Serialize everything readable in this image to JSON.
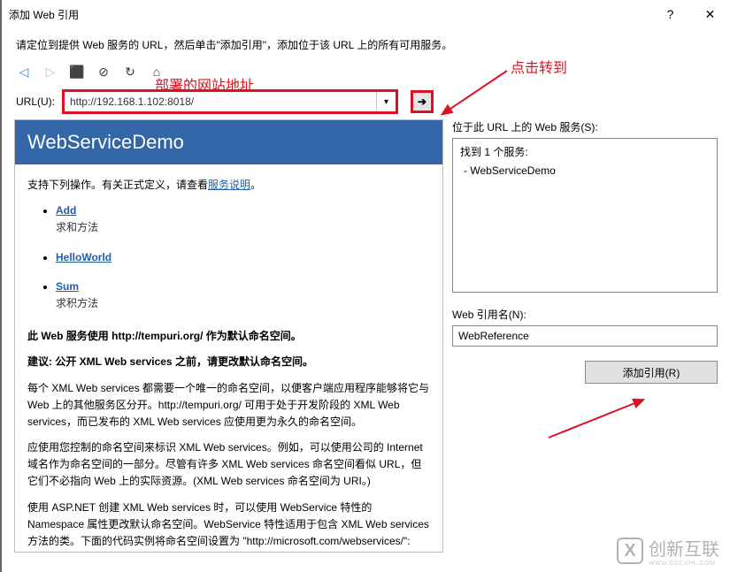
{
  "titlebar": {
    "title": "添加 Web 引用",
    "help": "?",
    "close": "✕"
  },
  "instructions": "请定位到提供 Web 服务的 URL，然后单击\"添加引用\"，添加位于该 URL 上的所有可用服务。",
  "toolbar": {
    "back": "◁",
    "fwd": "▷",
    "stop": "⬛",
    "cancel": "⊘",
    "refresh": "↻",
    "home": "⌂"
  },
  "url": {
    "label": "URL(U):",
    "value": "http://192.168.1.102:8018/",
    "go": "➔"
  },
  "annotations": {
    "url_text": "部署的网站地址",
    "go_text": "点击转到"
  },
  "service": {
    "header": "WebServiceDemo",
    "intro_prefix": "支持下列操作。有关正式定义，请查看",
    "intro_link": "服务说明",
    "intro_suffix": "。",
    "ops": [
      {
        "name": "Add",
        "desc": "求和方法"
      },
      {
        "name": "HelloWorld",
        "desc": ""
      },
      {
        "name": "Sum",
        "desc": "求积方法"
      }
    ],
    "p1": "此 Web 服务使用 http://tempuri.org/ 作为默认命名空间。",
    "p2": "建议: 公开 XML Web services 之前，请更改默认命名空间。",
    "p3": "每个 XML Web services 都需要一个唯一的命名空间，以便客户端应用程序能够将它与 Web 上的其他服务区分开。http://tempuri.org/ 可用于处于开发阶段的 XML Web services，而已发布的 XML Web services 应使用更为永久的命名空间。",
    "p4": "应使用您控制的命名空间来标识 XML Web services。例如，可以使用公司的 Internet 域名作为命名空间的一部分。尽管有许多 XML Web services 命名空间看似 URL，但它们不必指向 Web 上的实际资源。(XML Web services 命名空间为 URI。)",
    "p5": "使用 ASP.NET 创建 XML Web services 时，可以使用 WebService 特性的 Namespace 属性更改默认命名空间。WebService 特性适用于包含 XML Web services 方法的类。下面的代码实例将命名空间设置为 \"http://microsoft.com/webservices/\":"
  },
  "right": {
    "services_label": "位于此 URL 上的 Web 服务(S):",
    "found": "找到 1 个服务:",
    "item": "- WebServiceDemo",
    "refname_label": "Web 引用名(N):",
    "refname_value": "WebReference",
    "addref_label": "添加引用(R)"
  },
  "watermark": {
    "logo": "X",
    "text": "创新互联",
    "sub": "WWW.CDCXHL.COM"
  }
}
